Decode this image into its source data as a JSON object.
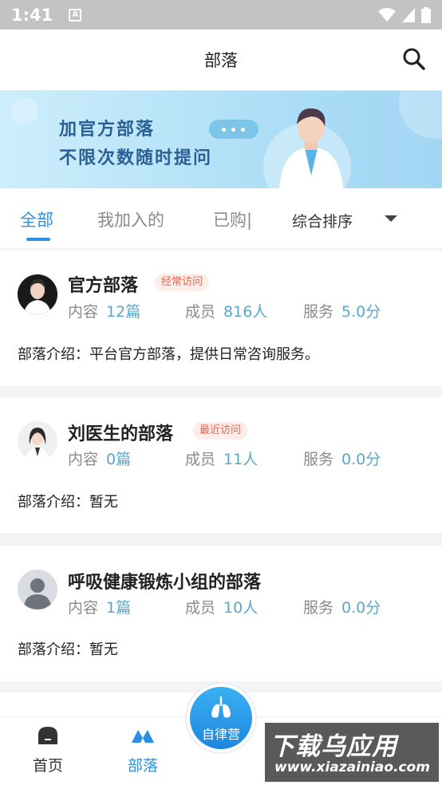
{
  "status": {
    "time": "1:41"
  },
  "header": {
    "title": "部落"
  },
  "banner": {
    "line1": "加官方部落",
    "line2": "不限次数随时提问"
  },
  "tabs": [
    {
      "label": "全部",
      "active": true
    },
    {
      "label": "我加入的",
      "active": false
    },
    {
      "label": "已购|",
      "active": false
    }
  ],
  "sort": {
    "label": "综合排序"
  },
  "tribes": [
    {
      "name": "官方部落",
      "badge": "经常访问",
      "content_label": "内容",
      "content": "12篇",
      "members_label": "成员",
      "members": "816人",
      "service_label": "服务",
      "service": "5.0分",
      "intro_label": "部落介绍：",
      "intro": "平台官方部落，提供日常咨询服务。"
    },
    {
      "name": "刘医生的部落",
      "badge": "最近访问",
      "content_label": "内容",
      "content": "0篇",
      "members_label": "成员",
      "members": "11人",
      "service_label": "服务",
      "service": "0.0分",
      "intro_label": "部落介绍：",
      "intro": "暂无"
    },
    {
      "name": "呼吸健康锻炼小组的部落",
      "badge": "",
      "content_label": "内容",
      "content": "1篇",
      "members_label": "成员",
      "members": "10人",
      "service_label": "服务",
      "service": "0.0分",
      "intro_label": "部落介绍：",
      "intro": "暂无"
    }
  ],
  "bottom_nav": {
    "home": "首页",
    "tribe": "部落",
    "fab": "自律营"
  },
  "watermark": {
    "big": "下载乌应用",
    "small": "www.xiazainiao.com"
  },
  "colors": {
    "accent": "#2a8fe6",
    "badge_text": "#e06a52",
    "stat_value": "#5aa7c6"
  }
}
